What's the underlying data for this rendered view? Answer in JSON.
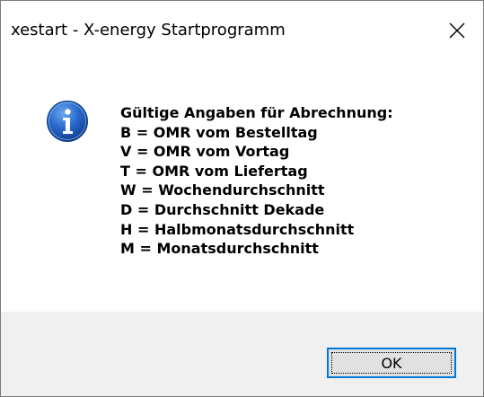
{
  "window": {
    "title": "xestart - X-energy Startprogramm",
    "close_icon": "close-icon"
  },
  "dialog": {
    "icon": "info-icon",
    "message_lines": [
      "Gültige Angaben für Abrechnung:",
      "B = OMR vom Bestelltag",
      "V = OMR vom Vortag",
      "T = OMR vom Liefertag",
      "W = Wochendurchschnitt",
      "D = Durchschnitt Dekade",
      "H = Halbmonatsdurchschnitt",
      "M = Monatsdurchschnitt"
    ]
  },
  "buttons": {
    "ok_label": "OK"
  },
  "colors": {
    "accent": "#0078d7",
    "info_icon_blue": "#1e5fbf",
    "footer_bg": "#f0f0f0"
  }
}
